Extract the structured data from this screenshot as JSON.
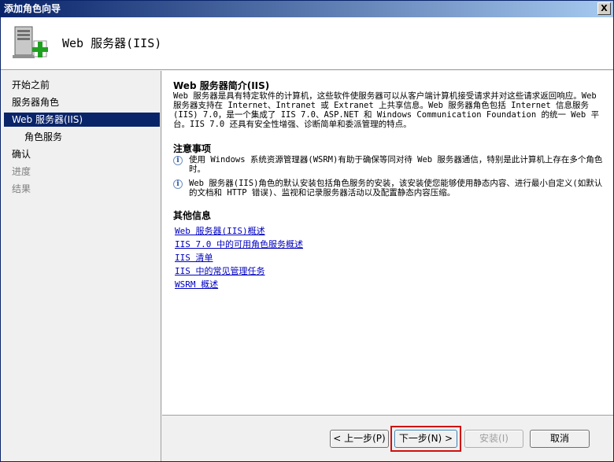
{
  "window": {
    "title": "添加角色向导",
    "close_label": "X"
  },
  "header": {
    "title": "Web 服务器(IIS)",
    "icon": "server-add-icon"
  },
  "sidebar": {
    "items": [
      {
        "label": "开始之前",
        "state": "normal"
      },
      {
        "label": "服务器角色",
        "state": "normal"
      },
      {
        "label": "Web 服务器(IIS)",
        "state": "active"
      },
      {
        "label": "角色服务",
        "state": "normal"
      },
      {
        "label": "确认",
        "state": "normal"
      },
      {
        "label": "进度",
        "state": "disabled"
      },
      {
        "label": "结果",
        "state": "disabled"
      }
    ]
  },
  "content": {
    "intro_title": "Web 服务器简介(IIS)",
    "intro_text": "Web 服务器是具有特定软件的计算机，这些软件使服务器可以从客户端计算机接受请求并对这些请求返回响应。Web 服务器支持在 Internet、Intranet 或 Extranet 上共享信息。Web 服务器角色包括 Internet 信息服务(IIS) 7.0，是一个集成了 IIS 7.0、ASP.NET 和 Windows Communication Foundation 的统一 Web 平台。IIS 7.0 还具有安全性增强、诊断简单和委派管理的特点。",
    "notes_title": "注意事项",
    "notes": [
      "使用 Windows 系统资源管理器(WSRM)有助于确保等同对待 Web 服务器通信，特别是此计算机上存在多个角色时。",
      "Web 服务器(IIS)角色的默认安装包括角色服务的安装，该安装使您能够使用静态内容、进行最小自定义(如默认的文档和 HTTP 错误)、监视和记录服务器活动以及配置静态内容压缩。"
    ],
    "more_title": "其他信息",
    "links": [
      "Web 服务器(IIS)概述",
      "IIS 7.0 中的可用角色服务概述",
      "IIS 清单",
      "IIS 中的常见管理任务",
      "WSRM 概述"
    ]
  },
  "buttons": {
    "back": "< 上一步(P)",
    "next": "下一步(N) >",
    "install": "安装(I)",
    "cancel": "取消"
  },
  "colors": {
    "active_nav": "#0a246a",
    "highlight": "#d01010",
    "link": "#0000c0"
  }
}
